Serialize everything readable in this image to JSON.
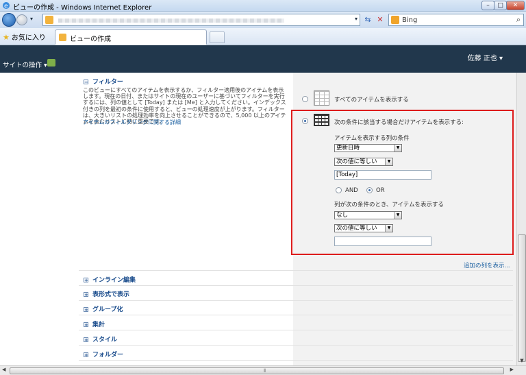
{
  "window": {
    "title": "ビューの作成 - Windows Internet Explorer",
    "min": "–",
    "max": "□",
    "close": "✕"
  },
  "browser": {
    "search_provider": "Bing",
    "search_icon": "magnifier-icon"
  },
  "favorites": {
    "label": "お気に入り"
  },
  "tab": {
    "label": "ビューの作成"
  },
  "ribbon": {
    "site_actions": "サイトの操作 ▾",
    "user": "佐藤 正也 ▾"
  },
  "filter": {
    "heading": "フィルター",
    "description": "このビューにすべてのアイテムを表示するか、フィルター適用後のアイテムを表示します。現在の日付、またはサイトの現在のユーザーに基づいてフィルターを実行するには、列の値として [Today] または [Me] と入力してください。インデックス付きの列を最初の条件に使用すると、ビューの処理速度が上がります。フィルターは、大きいリストの処理効率を向上させることができるので、5,000 以上のアイテムを含むリストに特に重要です。",
    "link": "アイテムのフィルタリングに関する詳細",
    "option_all": "すべてのアイテムを表示する",
    "option_conditional": "次の条件に該当する場合だけアイテムを表示する:",
    "cond1_label": "アイテムを表示する列の条件",
    "cond1_column": "更新日時",
    "cond1_operator": "次の値に等しい",
    "cond1_value": "[Today]",
    "and_label": "AND",
    "or_label": "OR",
    "cond2_label": "列が次の条件のとき、アイテムを表示する",
    "cond2_column": "なし",
    "cond2_operator": "次の値に等しい",
    "cond2_value": "",
    "add_columns": "追加の列を表示..."
  },
  "sections": [
    {
      "label": "インライン編集"
    },
    {
      "label": "表形式で表示"
    },
    {
      "label": "グループ化"
    },
    {
      "label": "集計"
    },
    {
      "label": "スタイル"
    },
    {
      "label": "フォルダー"
    }
  ],
  "colors": {
    "ribbon": "#21374c",
    "highlight": "#dd1b1b",
    "link": "#1a5fa0"
  }
}
